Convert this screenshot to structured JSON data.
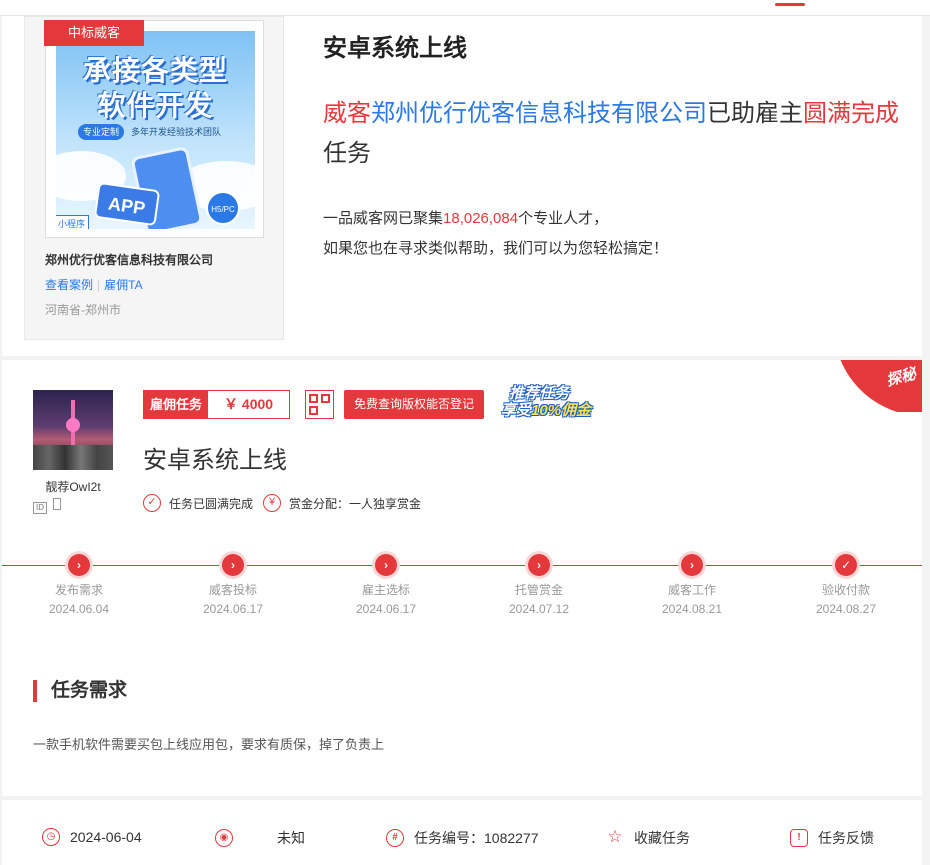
{
  "case": {
    "badge": "中标威客",
    "ad_line1": "承接各类型",
    "ad_line2": "软件开发",
    "ad_tag": "专业定制",
    "ad_sub": "多年开发经验技术团队",
    "ad_app": "APP",
    "ad_h5": "H5/PC",
    "ad_mini": "小程序",
    "company": "郑州优行优客信息科技有限公司",
    "link_cases": "查看案例",
    "link_separator": "|",
    "link_hire": "雇佣TA",
    "region": "河南省-郑州市"
  },
  "summary": {
    "title": "安卓系统上线",
    "h_part1": "威客",
    "h_company": "郑州优行优客信息科技有限公司",
    "h_part2": "已助雇主",
    "h_part3": "圆满完成",
    "h_part4": "任务",
    "stats_prefix": "一品威客网已聚集",
    "stats_count": "18,026,084",
    "stats_suffix": "个专业人才，",
    "stats_line2": "如果您也在寻求类似帮助，我们可以为您轻松搞定！"
  },
  "task": {
    "employer_name": "靓荐OwI2t",
    "price_label": "雇佣任务",
    "price_amount": "￥ 4000",
    "copyright_button": "免费查询版权能否登记",
    "promo_line1": "推荐任务",
    "promo_line2_a": "享受",
    "promo_line2_b": "10%佣金",
    "corner_label": "探秘",
    "name": "安卓系统上线",
    "status_done": "任务已圆满完成",
    "reward_split": "赏金分配：一人独享赏金"
  },
  "timeline": {
    "steps": [
      {
        "name": "发布需求",
        "date": "2024.06.04"
      },
      {
        "name": "威客投标",
        "date": "2024.06.17"
      },
      {
        "name": "雇主选标",
        "date": "2024.06.17"
      },
      {
        "name": "托管赏金",
        "date": "2024.07.12"
      },
      {
        "name": "威客工作",
        "date": "2024.08.21"
      },
      {
        "name": "验收付款",
        "date": "2024.08.27"
      }
    ]
  },
  "requirement": {
    "title": "任务需求",
    "text": "一款手机软件需要买包上线应用包，要求有质保，掉了负责上"
  },
  "footer": {
    "date": "2024-06-04",
    "location": "未知",
    "task_no": "任务编号：1082277",
    "favorite": "收藏任务",
    "feedback": "任务反馈"
  },
  "colors": {
    "accent": "#e4393c",
    "link": "#2b79e6"
  }
}
